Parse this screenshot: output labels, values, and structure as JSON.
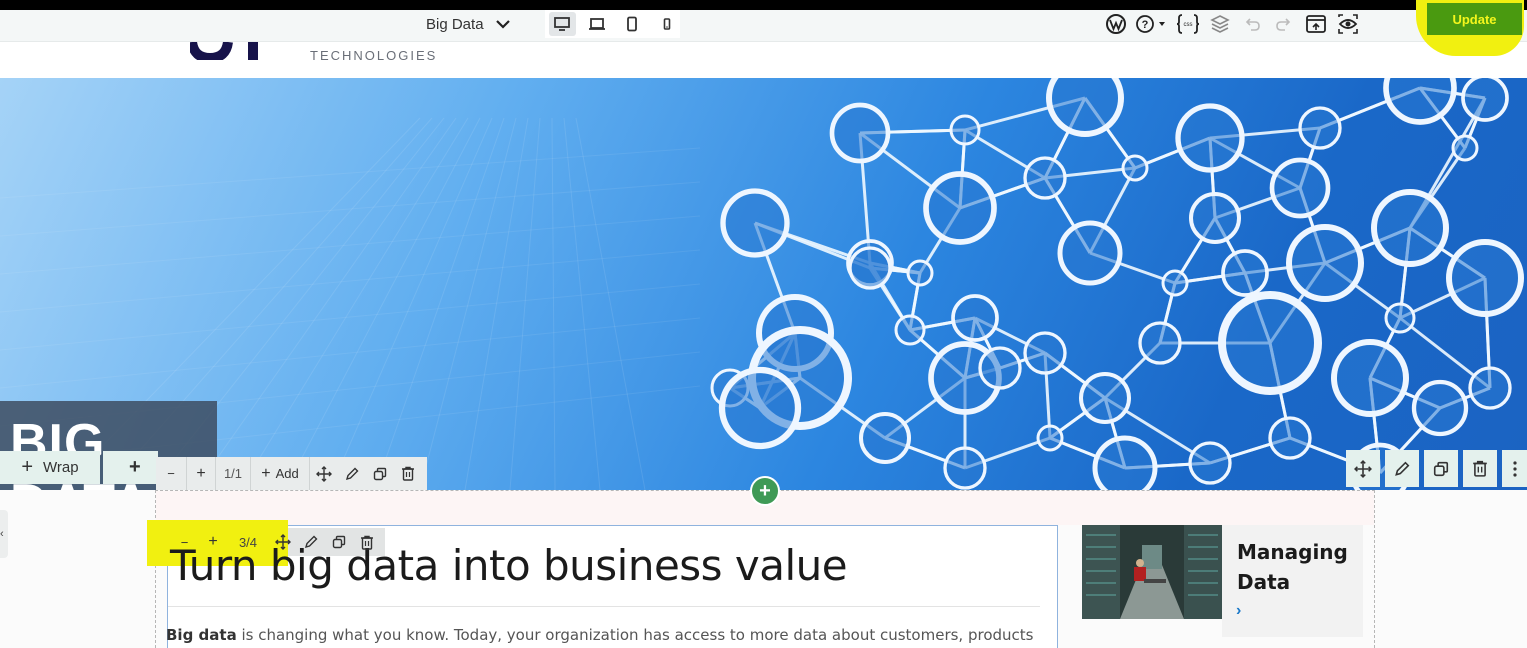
{
  "toolbar": {
    "page_title": "Big Data",
    "devices": [
      "desktop",
      "laptop",
      "tablet",
      "mobile"
    ],
    "active_device": "desktop",
    "update_label": "Update",
    "right_icons": [
      "wordpress-icon",
      "help-icon",
      "css-icon",
      "layers-icon",
      "undo-icon",
      "redo-icon",
      "save-template-icon",
      "preview-icon"
    ]
  },
  "header": {
    "logo_subtitle": "TECHNOLOGIES"
  },
  "hero": {
    "label": "BIG DATA"
  },
  "section_toolbar": {
    "wrap_label": "Wrap",
    "row_minus": "−",
    "row_plus": "+",
    "row_count": "1/1",
    "add_label": "Add"
  },
  "column_toolbar": {
    "minus": "−",
    "plus": "+",
    "count": "3/4"
  },
  "content": {
    "title": "Turn big data into business value",
    "paragraph_bold": "Big data",
    "paragraph_rest": " is changing what you know. Today, your organization has access to more data about customers, products"
  },
  "side_card": {
    "title": "Managing Data",
    "arrow": "›"
  },
  "colors": {
    "accent_green": "#4a9a10",
    "highlight_yellow": "#f1f010",
    "add_green": "#3f9a56",
    "link_blue": "#1a78c8"
  }
}
